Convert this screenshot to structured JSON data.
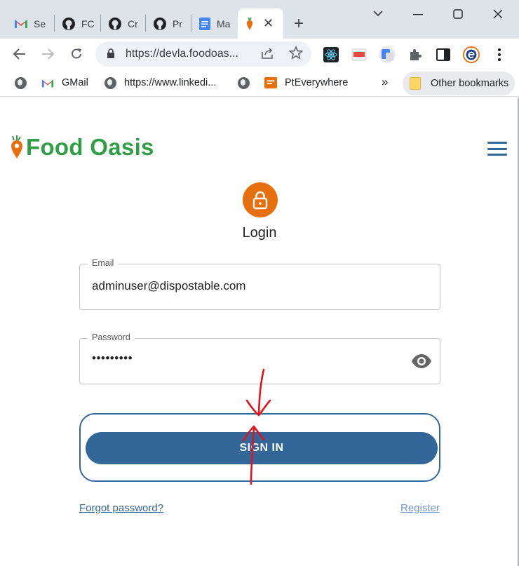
{
  "browser": {
    "tabs": [
      {
        "title": "Se",
        "icon": "gmail-icon"
      },
      {
        "title": "FC",
        "icon": "github-icon"
      },
      {
        "title": "Cr",
        "icon": "github-icon"
      },
      {
        "title": "Pr",
        "icon": "github-icon"
      },
      {
        "title": "Ma",
        "icon": "docs-icon"
      }
    ],
    "active_tab": {
      "icon": "carrot-icon",
      "close": "✕"
    },
    "new_tab": "+",
    "url": "https://devla.foodoas...",
    "bookmarks": [
      {
        "label": "",
        "icon": "globe-icon"
      },
      {
        "label": "GMail",
        "icon": "gmail-icon"
      },
      {
        "label": "https://www.linkedi...",
        "icon": "globe-icon"
      },
      {
        "label": "",
        "icon": "globe-icon"
      },
      {
        "label": "PtEverywhere",
        "icon": "pte-icon"
      }
    ],
    "bookmarks_overflow": "»",
    "other_bookmarks": "Other bookmarks"
  },
  "page": {
    "brand_name": "Food Oasis",
    "login_title": "Login",
    "email": {
      "label": "Email",
      "value": "adminuser@dispostable.com"
    },
    "password": {
      "label": "Password",
      "masked_value": "•••••••••"
    },
    "signin_label": "SIGN IN",
    "forgot_label": "Forgot password?",
    "register_label": "Register"
  },
  "colors": {
    "brand_green": "#2f9e44",
    "primary_blue": "#336699",
    "lock_orange": "#e86f0d",
    "annotation_red": "#e0141e"
  }
}
